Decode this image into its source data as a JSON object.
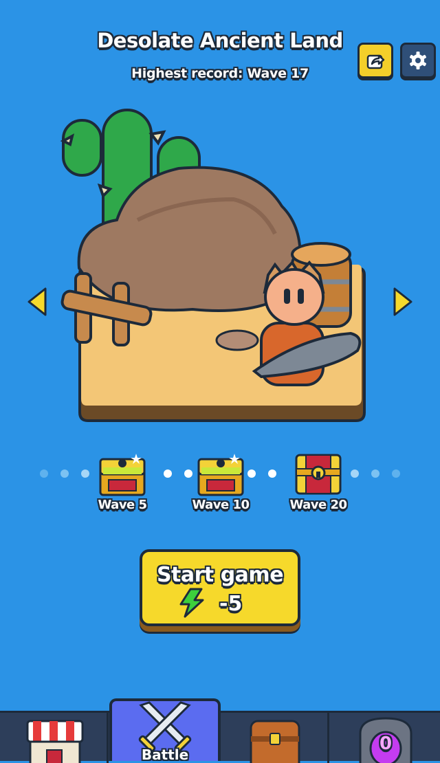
{
  "header": {
    "title": "Desolate Ancient Land",
    "highest_record": "Highest record: Wave 17"
  },
  "top_buttons": {
    "share_icon": "share-icon",
    "settings_icon": "gear-icon"
  },
  "level_nav": {
    "prev_icon": "triangle-left-icon",
    "next_icon": "triangle-right-icon"
  },
  "rewards": [
    {
      "label": "Wave 5",
      "state": "claimable"
    },
    {
      "label": "Wave 10",
      "state": "claimable"
    },
    {
      "label": "Wave 20",
      "state": "locked"
    }
  ],
  "start_button": {
    "label": "Start game",
    "cost": "-5",
    "cost_icon": "energy-bolt-icon"
  },
  "bottom_nav": {
    "tabs": [
      {
        "name": "shop",
        "icon": "shop-icon",
        "label": ""
      },
      {
        "name": "battle",
        "icon": "crossed-swords-icon",
        "label": "Battle",
        "active": true
      },
      {
        "name": "inventory",
        "icon": "chest-icon",
        "label": ""
      },
      {
        "name": "portal",
        "icon": "portal-icon",
        "label": ""
      }
    ],
    "portal_badge": "0"
  },
  "colors": {
    "background": "#2b93e6",
    "accent_yellow": "#f6d92b",
    "outline": "#1d2a3a",
    "active_tab": "#5b6cf0",
    "nav_bg": "#2d3e5a",
    "energy_green": "#3ccf3c"
  }
}
